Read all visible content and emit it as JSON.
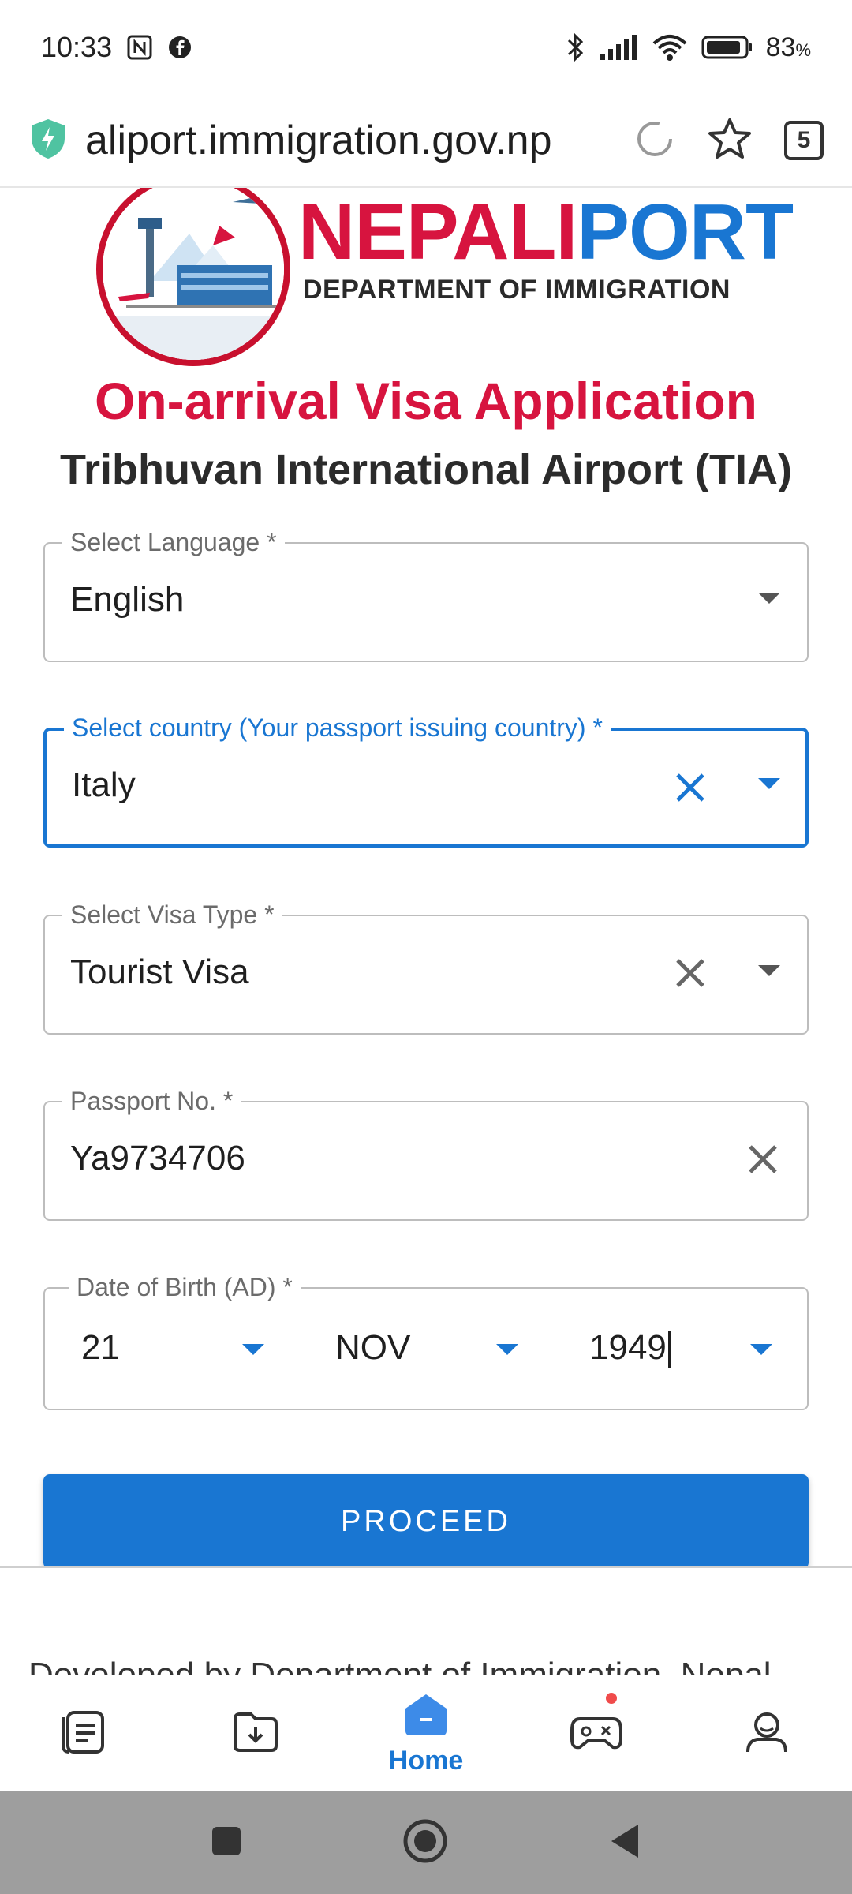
{
  "status_bar": {
    "time": "10:33",
    "battery": "83"
  },
  "browser": {
    "url": "aliport.immigration.gov.np",
    "tab_count": "5"
  },
  "header": {
    "brand_part1": "NEPALI",
    "brand_part2": "PORT",
    "brand_sub": "DEPARTMENT OF IMMIGRATION",
    "title": "On-arrival Visa Application",
    "subtitle": "Tribhuvan International Airport (TIA)"
  },
  "form": {
    "language": {
      "label": "Select Language *",
      "value": "English"
    },
    "country": {
      "label": "Select country (Your passport issuing country) *",
      "value": "Italy"
    },
    "visa_type": {
      "label": "Select Visa Type *",
      "value": "Tourist Visa"
    },
    "passport": {
      "label": "Passport No. *",
      "value": "Ya9734706"
    },
    "dob": {
      "label": "Date of Birth (AD) *",
      "day": "21",
      "month": "NOV",
      "year": "1949"
    },
    "proceed_label": "PROCEED"
  },
  "footer": {
    "developed_by": "Developed by   Department of Immigration, Nepal"
  },
  "bottom_nav": {
    "home_label": "Home"
  },
  "colors": {
    "brand_red": "#d7143f",
    "brand_blue": "#1976d2"
  }
}
